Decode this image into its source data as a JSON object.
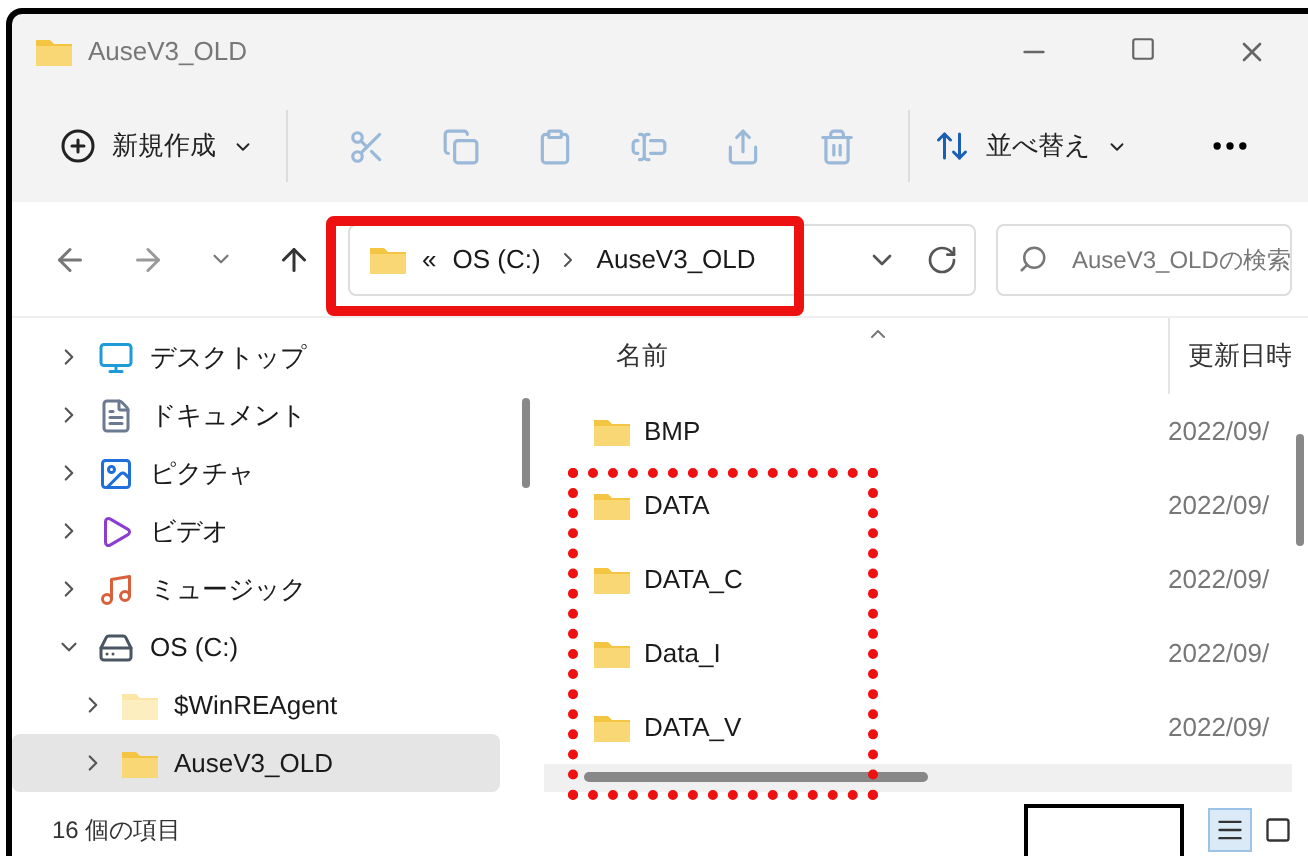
{
  "window": {
    "title": "AuseV3_OLD"
  },
  "toolbar": {
    "new_label": "新規作成",
    "tools": [
      {
        "kind": "cut",
        "disabled": true
      },
      {
        "kind": "copy",
        "disabled": true
      },
      {
        "kind": "paste",
        "disabled": true
      },
      {
        "kind": "rename",
        "disabled": true
      },
      {
        "kind": "share",
        "disabled": true
      },
      {
        "kind": "delete",
        "disabled": true
      }
    ],
    "sort_label": "並べ替え"
  },
  "address": {
    "prefix": "«",
    "path": [
      "OS (C:)",
      "AuseV3_OLD"
    ]
  },
  "search": {
    "placeholder": "AuseV3_OLDの検索"
  },
  "sidebar": {
    "items": [
      {
        "label": "デスクトップ",
        "kind": "desktop",
        "expanded": false,
        "selected": false
      },
      {
        "label": "ドキュメント",
        "kind": "documents",
        "expanded": false,
        "selected": false
      },
      {
        "label": "ピクチャ",
        "kind": "pictures",
        "expanded": false,
        "selected": false
      },
      {
        "label": "ビデオ",
        "kind": "videos",
        "expanded": false,
        "selected": false
      },
      {
        "label": "ミュージック",
        "kind": "music",
        "expanded": false,
        "selected": false
      },
      {
        "label": "OS (C:)",
        "kind": "drive",
        "expanded": true,
        "selected": false,
        "children": [
          {
            "label": "$WinREAgent",
            "kind": "hidden-folder",
            "expanded": false,
            "selected": false
          },
          {
            "label": "AuseV3_OLD",
            "kind": "folder",
            "expanded": false,
            "selected": true
          }
        ]
      }
    ]
  },
  "table": {
    "columns": [
      "名前",
      "更新日時"
    ],
    "rows": [
      {
        "name": "BMP",
        "modified": "2022/09/"
      },
      {
        "name": "DATA",
        "modified": "2022/09/"
      },
      {
        "name": "DATA_C",
        "modified": "2022/09/"
      },
      {
        "name": "Data_I",
        "modified": "2022/09/"
      },
      {
        "name": "DATA_V",
        "modified": "2022/09/"
      }
    ]
  },
  "status_bar": {
    "count": "16 個の項目",
    "views": [
      {
        "kind": "details",
        "selected": true
      },
      {
        "kind": "tiles",
        "selected": false
      }
    ]
  },
  "annotations": [
    {
      "kind": "solid"
    },
    {
      "kind": "dotted"
    },
    {
      "kind": "blank"
    }
  ]
}
